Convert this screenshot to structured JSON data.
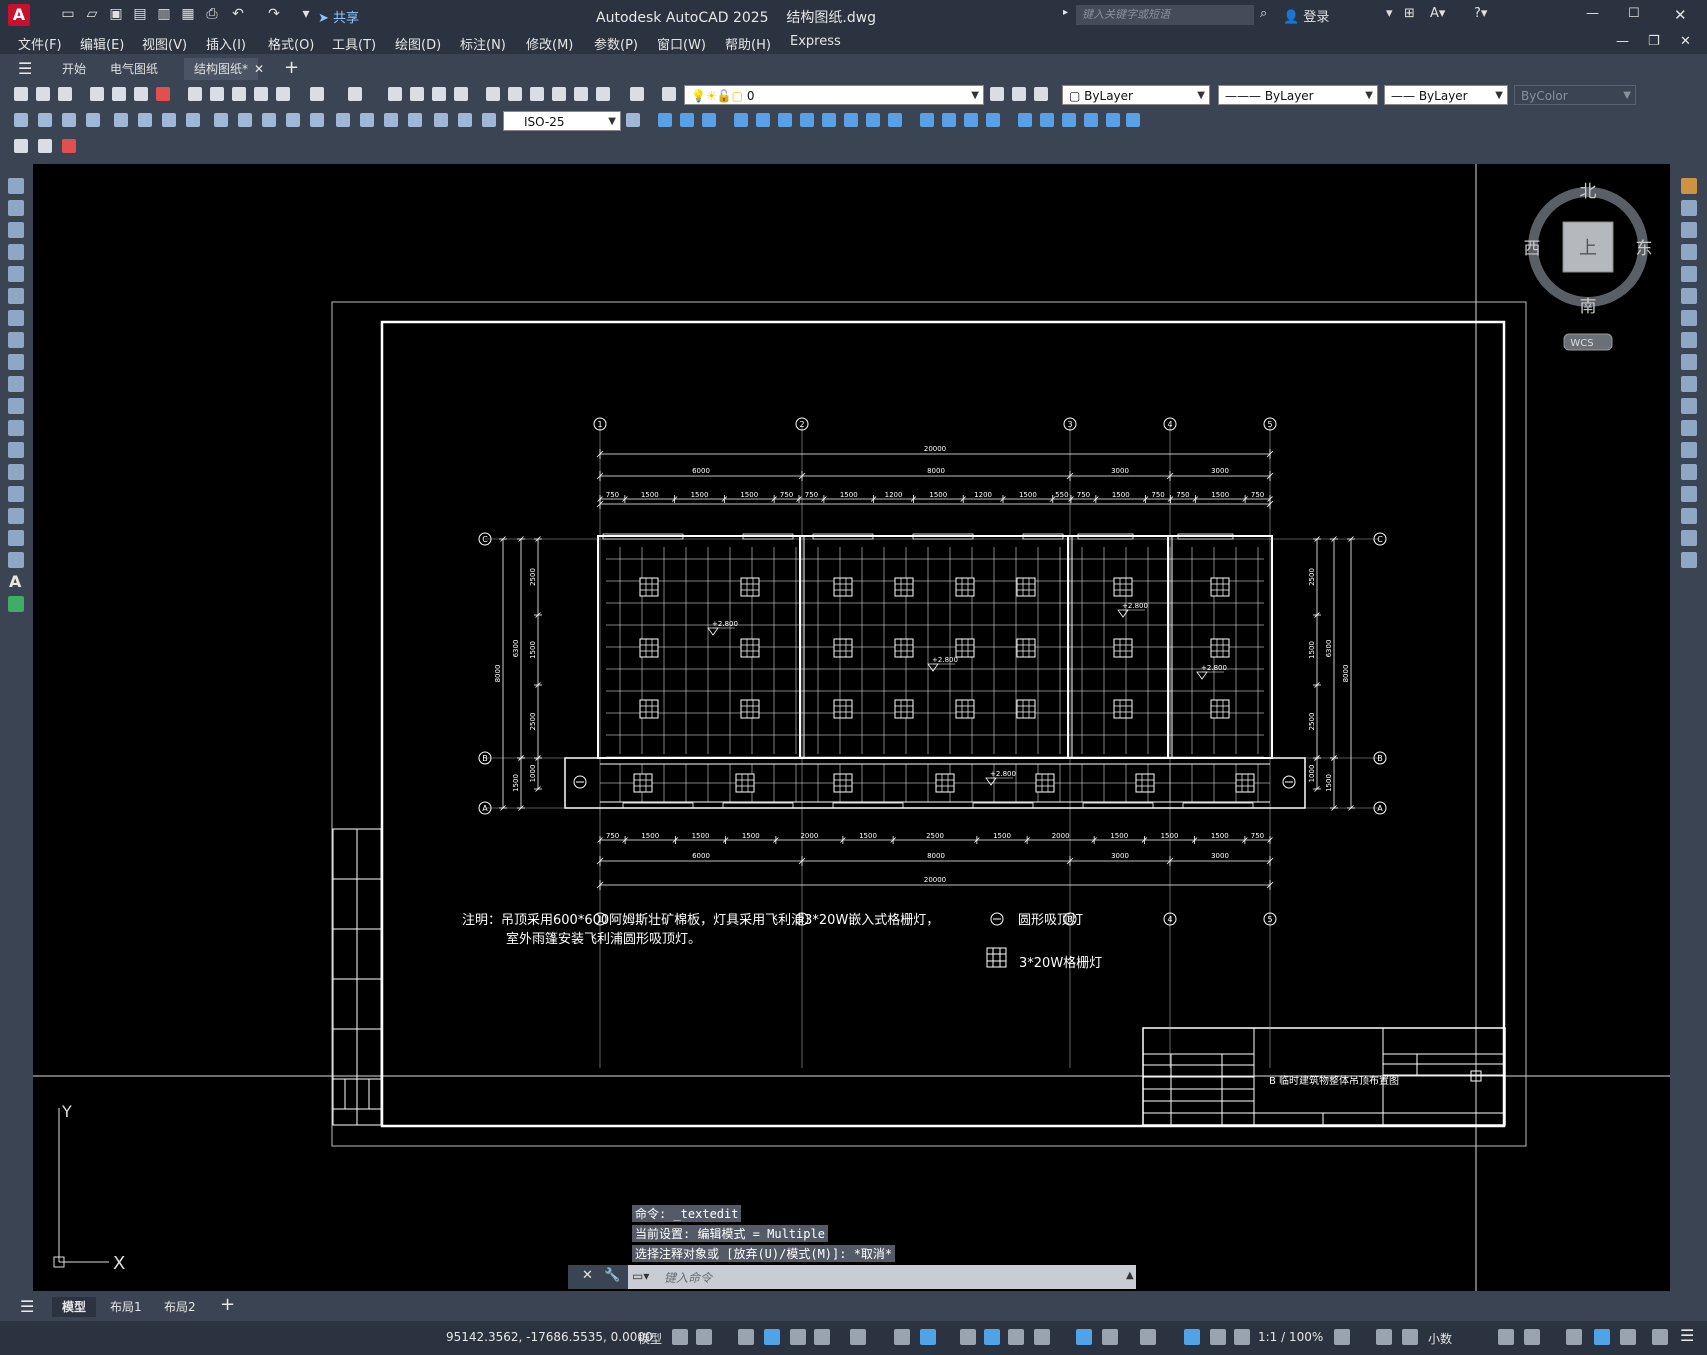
{
  "window": {
    "app_title": "Autodesk AutoCAD 2025",
    "file_name": "结构图纸.dwg",
    "search_placeholder": "键入关键字或短语",
    "login": "登录",
    "share": "共享"
  },
  "menu": [
    "文件(F)",
    "编辑(E)",
    "视图(V)",
    "插入(I)",
    "格式(O)",
    "工具(T)",
    "绘图(D)",
    "标注(N)",
    "修改(M)",
    "参数(P)",
    "窗口(W)",
    "帮助(H)",
    "Express"
  ],
  "doc_tabs": [
    {
      "label": "开始",
      "active": false
    },
    {
      "label": "电气图纸",
      "active": false
    },
    {
      "label": "结构图纸*",
      "active": true
    }
  ],
  "toolbar": {
    "layer_value": "0",
    "color_value": "ByLayer",
    "linetype_value": "ByLayer",
    "lineweight_value": "ByLayer",
    "plotstyle_value": "ByColor",
    "dimstyle_value": "ISO-25"
  },
  "viewcube": {
    "north": "北",
    "south": "南",
    "east": "东",
    "west": "西",
    "top": "上",
    "wcs": "WCS"
  },
  "drawing": {
    "axes_top": [
      "1",
      "2",
      "3",
      "4",
      "5"
    ],
    "axes_side": [
      "C",
      "B",
      "A"
    ],
    "dim_total": "20000",
    "dim_spans": [
      "6000",
      "8000",
      "3000",
      "3000"
    ],
    "dim_top_detail": [
      "750",
      "1500",
      "1500",
      "1500",
      "750",
      "750",
      "1500",
      "1200",
      "1500",
      "1200",
      "1500",
      "550",
      "750",
      "1500",
      "750",
      "750",
      "1500",
      "750"
    ],
    "dim_bottom_detail": [
      "750",
      "1500",
      "1500",
      "1500",
      "2000",
      "1500",
      "2500",
      "1500",
      "2000",
      "1500",
      "1500",
      "1500",
      "750"
    ],
    "dim_left": [
      "2500",
      "1500",
      "2500",
      "6300",
      "8000",
      "1500",
      "1000"
    ],
    "elevation": "+2.800",
    "note_line1": "注明：吊顶采用600*600阿姆斯壮矿棉板，灯具采用飞利浦3*20W嵌入式格栅灯，",
    "note_line2": "室外雨篷安装飞利浦圆形吸顶灯。",
    "legend_round": "圆形吸顶灯",
    "legend_grid": "3*20W格栅灯",
    "title_block_name": "B 临时建筑物整体吊顶布置图"
  },
  "ucs": {
    "x": "X",
    "y": "Y"
  },
  "command_history": [
    "命令: _textedit",
    "当前设置: 编辑模式 = Multiple",
    "选择注释对象或 [放弃(U)/模式(M)]: *取消*"
  ],
  "command_placeholder": "键入命令",
  "layout_tabs": [
    {
      "label": "模型",
      "active": true
    },
    {
      "label": "布局1",
      "active": false
    },
    {
      "label": "布局2",
      "active": false
    }
  ],
  "status": {
    "coords": "95142.3562, -17686.5535, 0.0000",
    "mode": "模型",
    "scale": "1:1 / 100%",
    "units": "小数"
  }
}
